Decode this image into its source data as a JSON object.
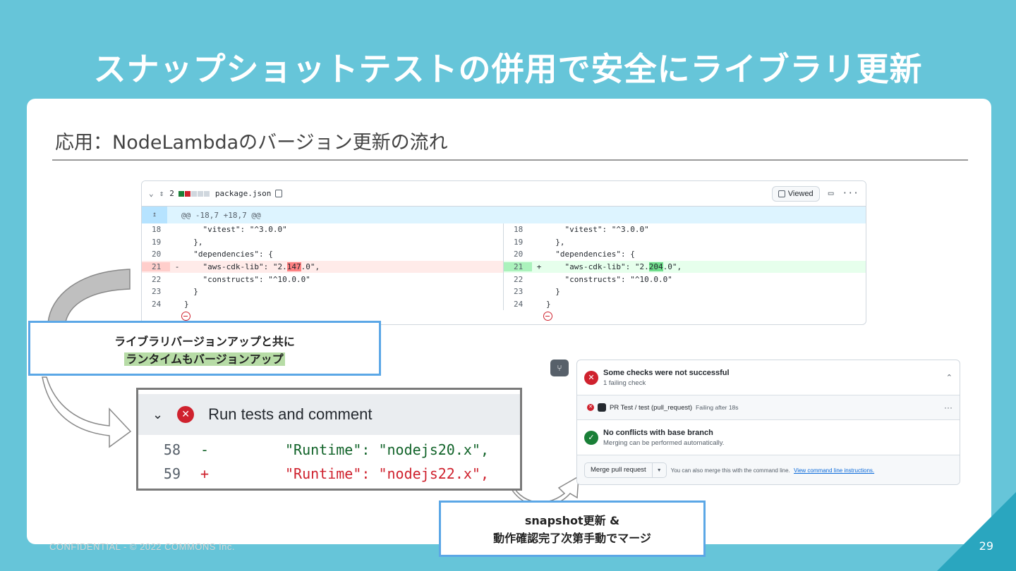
{
  "slide": {
    "title": "スナップショットテストの併用で安全にライブラリ更新",
    "subtitle": "応用：NodeLambdaのバージョン更新の流れ",
    "footer": "CONFIDENTIAL - © 2022 COMMONS Inc.",
    "page_number": "29"
  },
  "diff": {
    "file_count": "2",
    "filename": "package.json",
    "viewed_label": "Viewed",
    "hunk_header": "@@ -18,7 +18,7 @@",
    "left_lines": [
      {
        "n": "18",
        "mark": " ",
        "code": "    \"vitest\": \"^3.0.0\"",
        "type": "ctx"
      },
      {
        "n": "19",
        "mark": " ",
        "code": "  },",
        "type": "ctx"
      },
      {
        "n": "20",
        "mark": " ",
        "code": "  \"dependencies\": {",
        "type": "ctx"
      },
      {
        "n": "21",
        "mark": "-",
        "code_pre": "    \"aws-cdk-lib\": \"2.",
        "code_hl": "147",
        "code_post": ".0\",",
        "type": "del"
      },
      {
        "n": "22",
        "mark": " ",
        "code": "    \"constructs\": \"^10.0.0\"",
        "type": "ctx"
      },
      {
        "n": "23",
        "mark": " ",
        "code": "  }",
        "type": "ctx"
      },
      {
        "n": "24",
        "mark": " ",
        "code": "}",
        "type": "ctx"
      }
    ],
    "right_lines": [
      {
        "n": "18",
        "mark": " ",
        "code": "    \"vitest\": \"^3.0.0\"",
        "type": "ctx"
      },
      {
        "n": "19",
        "mark": " ",
        "code": "  },",
        "type": "ctx"
      },
      {
        "n": "20",
        "mark": " ",
        "code": "  \"dependencies\": {",
        "type": "ctx"
      },
      {
        "n": "21",
        "mark": "+",
        "code_pre": "    \"aws-cdk-lib\": \"2.",
        "code_hl": "204",
        "code_post": ".0\",",
        "type": "add"
      },
      {
        "n": "22",
        "mark": " ",
        "code": "    \"constructs\": \"^10.0.0\"",
        "type": "ctx"
      },
      {
        "n": "23",
        "mark": " ",
        "code": "  }",
        "type": "ctx"
      },
      {
        "n": "24",
        "mark": " ",
        "code": "}",
        "type": "ctx"
      }
    ]
  },
  "callout1": {
    "line1": "ライブラリバージョンアップと共に",
    "line2": "ランタイムもバージョンアップ"
  },
  "run_tests": {
    "title": "Run tests and comment",
    "lines": [
      {
        "n": "58",
        "mark": "-",
        "code": "\"Runtime\": \"nodejs20.x\","
      },
      {
        "n": "59",
        "mark": "+",
        "code": "\"Runtime\": \"nodejs22.x\","
      }
    ]
  },
  "checks": {
    "summary_title": "Some checks were not successful",
    "summary_sub": "1 failing check",
    "check_name": "PR Test / test (pull_request)",
    "check_status": "Failing after 18s",
    "conflicts_title": "No conflicts with base branch",
    "conflicts_sub": "Merging can be performed automatically.",
    "merge_button": "Merge pull request",
    "merge_note": "You can also merge this with the command line.",
    "merge_link": "View command line instructions."
  },
  "callout2": {
    "line1": "snapshot更新 &",
    "line2": "動作確認完了次第手動でマージ"
  },
  "colors": {
    "background": "#66c5d9",
    "callout_border": "#5ba7e6",
    "highlight": "#b7dca6",
    "error_red": "#cf222e",
    "success_green": "#1a7f37"
  }
}
